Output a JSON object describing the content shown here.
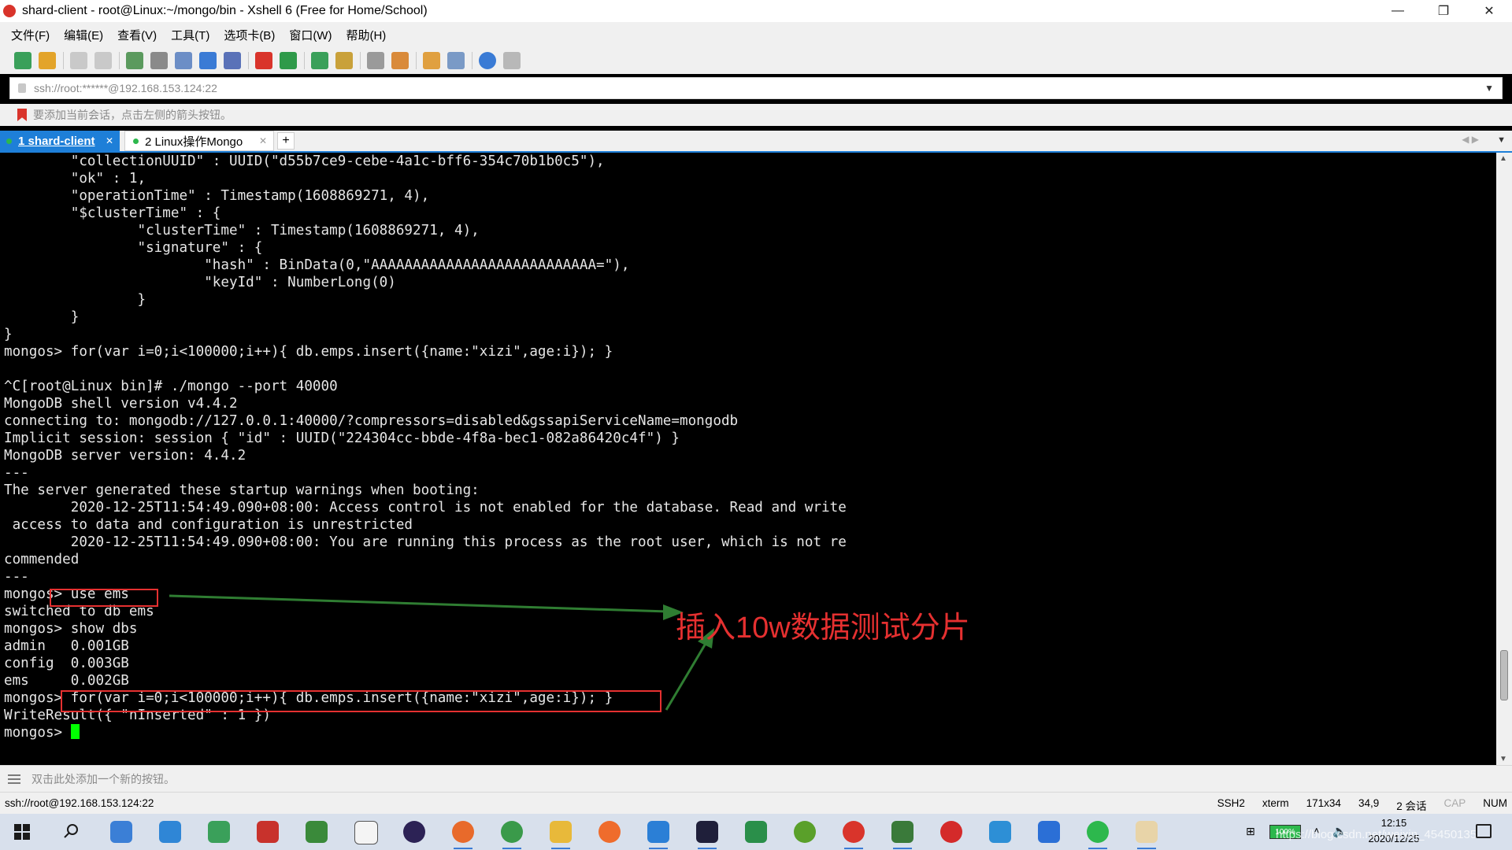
{
  "window": {
    "title": "shard-client - root@Linux:~/mongo/bin - Xshell 6 (Free for Home/School)"
  },
  "menu": [
    "文件(F)",
    "编辑(E)",
    "查看(V)",
    "工具(T)",
    "选项卡(B)",
    "窗口(W)",
    "帮助(H)"
  ],
  "address": {
    "value": "ssh://root:******@192.168.153.124:22"
  },
  "hint": "要添加当前会话，点击左侧的箭头按钮。",
  "tabs": [
    {
      "label": "1 shard-client",
      "active": true
    },
    {
      "label": "2 Linux操作Mongo",
      "active": false
    }
  ],
  "terminal": {
    "lines": [
      "        \"collectionUUID\" : UUID(\"d55b7ce9-cebe-4a1c-bff6-354c70b1b0c5\"),",
      "        \"ok\" : 1,",
      "        \"operationTime\" : Timestamp(1608869271, 4),",
      "        \"$clusterTime\" : {",
      "                \"clusterTime\" : Timestamp(1608869271, 4),",
      "                \"signature\" : {",
      "                        \"hash\" : BinData(0,\"AAAAAAAAAAAAAAAAAAAAAAAAAAA=\"),",
      "                        \"keyId\" : NumberLong(0)",
      "                }",
      "        }",
      "}",
      "mongos> for(var i=0;i<100000;i++){ db.emps.insert({name:\"xizi\",age:i}); }",
      "",
      "^C[root@Linux bin]# ./mongo --port 40000",
      "MongoDB shell version v4.4.2",
      "connecting to: mongodb://127.0.0.1:40000/?compressors=disabled&gssapiServiceName=mongodb",
      "Implicit session: session { \"id\" : UUID(\"224304cc-bbde-4f8a-bec1-082a86420c4f\") }",
      "MongoDB server version: 4.4.2",
      "---",
      "The server generated these startup warnings when booting:",
      "        2020-12-25T11:54:49.090+08:00: Access control is not enabled for the database. Read and write",
      " access to data and configuration is unrestricted",
      "        2020-12-25T11:54:49.090+08:00: You are running this process as the root user, which is not re",
      "commended",
      "---",
      "mongos> use ems",
      "switched to db ems",
      "mongos> show dbs",
      "admin   0.001GB",
      "config  0.003GB",
      "ems     0.002GB",
      "mongos> for(var i=0;i<100000;i++){ db.emps.insert({name:\"xizi\",age:i}); }",
      "WriteResult({ \"nInserted\" : 1 })"
    ],
    "prompt": "mongos> "
  },
  "annotation": {
    "text": "插入10w数据测试分片",
    "color": "#e53030",
    "arrow_color": "#2f7d32"
  },
  "quickbar": {
    "text": "双击此处添加一个新的按钮。"
  },
  "status": {
    "connection": "ssh://root@192.168.153.124:22",
    "protocol": "SSH2",
    "terminal_type": "xterm",
    "size": "171x34",
    "cursor_pos": "34,9",
    "sessions": "2 会话",
    "cap": "CAP",
    "num": "NUM"
  },
  "taskbar": {
    "battery": "100%",
    "time": "12:15",
    "date": "2020/12/25",
    "watermark": "https://blog.csdn.net/weixin_45450135",
    "icons": [
      "search-icon",
      "browser-icon",
      "tools-icon",
      "android-studio-icon",
      "books-icon",
      "sheets-icon",
      "typora-icon",
      "eclipse-icon",
      "firefox-icon",
      "chrome-icon",
      "explorer-icon",
      "postman-icon",
      "vscode-icon",
      "intellij-icon",
      "pycharm-icon",
      "wechat-game-icon",
      "xshell-icon",
      "xftp-icon",
      "netease-music-icon",
      "storage-icon",
      "word-icon",
      "wechat-icon",
      "avatar-icon"
    ],
    "colors": {
      "accent": "#1e7fd8",
      "terminal_bg": "#000000",
      "cursor": "#00ff00"
    }
  }
}
